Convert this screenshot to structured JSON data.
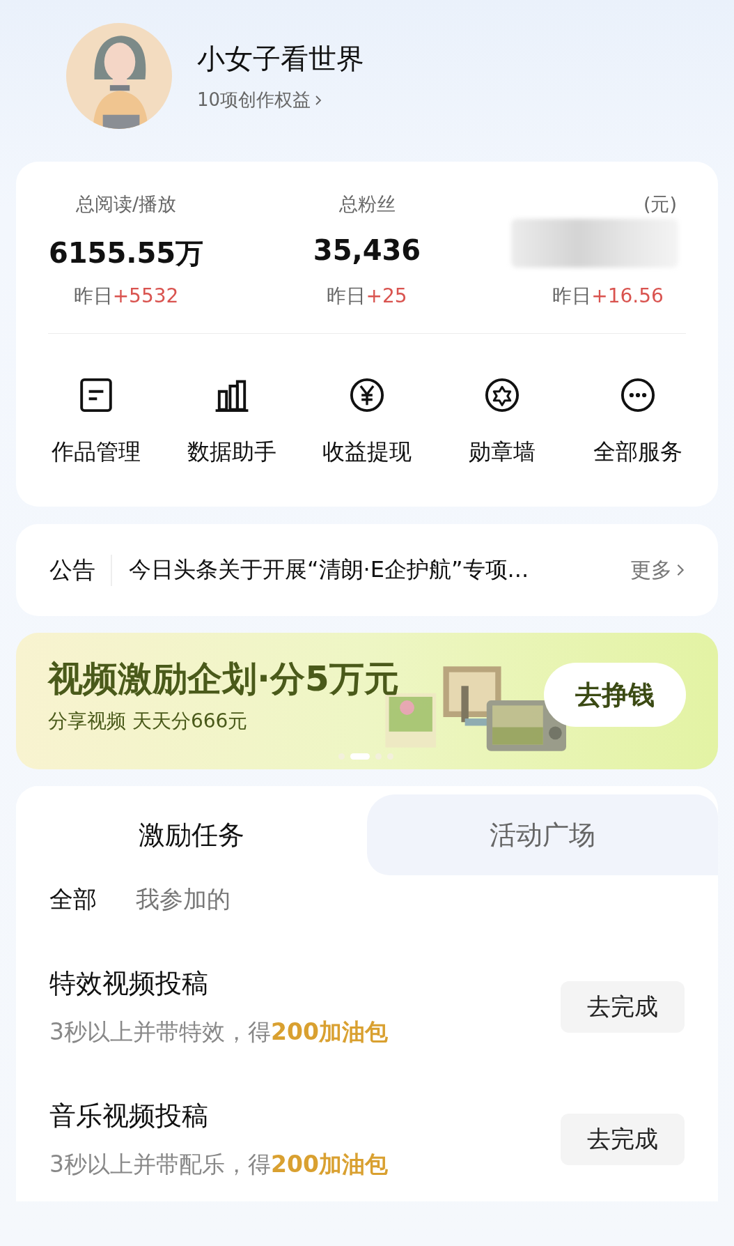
{
  "profile": {
    "name": "小女子看世界",
    "benefits": "10项创作权益"
  },
  "stats": [
    {
      "label": "总阅读/播放",
      "value": "6155.55万",
      "delta_label": "昨日",
      "delta": "+5532",
      "blurred": false
    },
    {
      "label": "总粉丝",
      "value": "35,436",
      "delta_label": "昨日",
      "delta": "+25",
      "blurred": false
    },
    {
      "label": "(元)",
      "delta_label": "昨日",
      "delta": "+16.56",
      "blurred": true
    }
  ],
  "services": [
    {
      "label": "作品管理",
      "kind": "doc"
    },
    {
      "label": "数据助手",
      "kind": "chart"
    },
    {
      "label": "收益提现",
      "kind": "yen"
    },
    {
      "label": "勋章墙",
      "kind": "badge"
    },
    {
      "label": "全部服务",
      "kind": "more"
    }
  ],
  "notice": {
    "tag": "公告",
    "text": "今日头条关于开展“清朗·E企护航”专项...",
    "more": "更多"
  },
  "banner": {
    "title": "视频激励企划·分5万元",
    "subtitle": "分享视频 天天分666元",
    "button": "去挣钱",
    "dots": [
      {
        "selected": false
      },
      {
        "selected": true
      },
      {
        "selected": false
      },
      {
        "selected": false
      }
    ]
  },
  "tabs": [
    {
      "label": "激励任务",
      "selected": true
    },
    {
      "label": "活动广场",
      "selected": false
    }
  ],
  "filters": [
    {
      "label": "全部",
      "selected": true
    },
    {
      "label": "我参加的",
      "selected": false
    }
  ],
  "tasks": [
    {
      "title": "特效视频投稿",
      "desc": "3秒以上并带特效，得**200加油包**",
      "button": "去完成"
    },
    {
      "title": "音乐视频投稿",
      "desc": "3秒以上并带配乐，得**200加油包**",
      "button": "去完成"
    }
  ]
}
